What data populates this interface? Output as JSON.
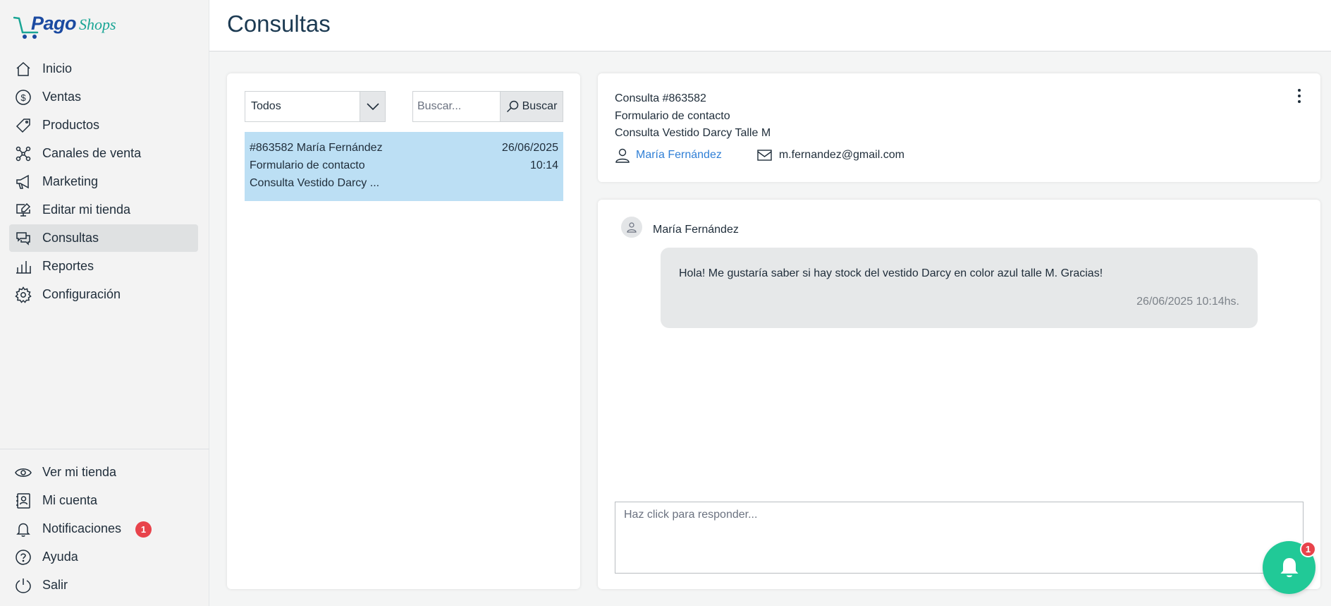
{
  "brand": {
    "name_part1": "Pago",
    "name_part2": "Shops"
  },
  "sidebar": {
    "items": [
      {
        "label": "Inicio",
        "icon": "home-icon"
      },
      {
        "label": "Ventas",
        "icon": "dollar-icon"
      },
      {
        "label": "Productos",
        "icon": "tag-icon"
      },
      {
        "label": "Canales de venta",
        "icon": "channels-icon"
      },
      {
        "label": "Marketing",
        "icon": "megaphone-icon"
      },
      {
        "label": "Editar mi tienda",
        "icon": "monitor-edit-icon"
      },
      {
        "label": "Consultas",
        "icon": "chat-icon",
        "active": true
      },
      {
        "label": "Reportes",
        "icon": "bar-chart-icon"
      },
      {
        "label": "Configuración",
        "icon": "gear-icon"
      }
    ],
    "bottom_items": [
      {
        "label": "Ver mi tienda",
        "icon": "eye-icon"
      },
      {
        "label": "Mi cuenta",
        "icon": "account-icon"
      },
      {
        "label": "Notificaciones",
        "icon": "bell-icon",
        "badge": "1"
      },
      {
        "label": "Ayuda",
        "icon": "help-icon"
      },
      {
        "label": "Salir",
        "icon": "power-icon"
      }
    ]
  },
  "header": {
    "title": "Consultas"
  },
  "list": {
    "filter": {
      "selected": "Todos"
    },
    "search": {
      "placeholder": "Buscar...",
      "button_label": "Buscar"
    },
    "messages": [
      {
        "title": "#863582 María Fernández",
        "date": "26/06/2025",
        "source": "Formulario de contacto",
        "time": "10:14",
        "subject": "Consulta Vestido Darcy ..."
      }
    ]
  },
  "detail": {
    "consulta_id": "Consulta #863582",
    "source": "Formulario de contacto",
    "subject": "Consulta Vestido Darcy Talle M",
    "customer_name": "María Fernández",
    "customer_email": "m.fernandez@gmail.com"
  },
  "chat": {
    "sender": "María Fernández",
    "message": "Hola! Me gustaría saber si hay stock del vestido Darcy en color azul talle M. Gracias!",
    "timestamp": "26/06/2025 10:14hs.",
    "reply_placeholder": "Haz click para responder..."
  },
  "fab": {
    "badge": "1"
  },
  "colors": {
    "accent": "#21c997",
    "selected_row": "#bcdff4",
    "link": "#2f7fd6",
    "badge": "#e8434b"
  }
}
